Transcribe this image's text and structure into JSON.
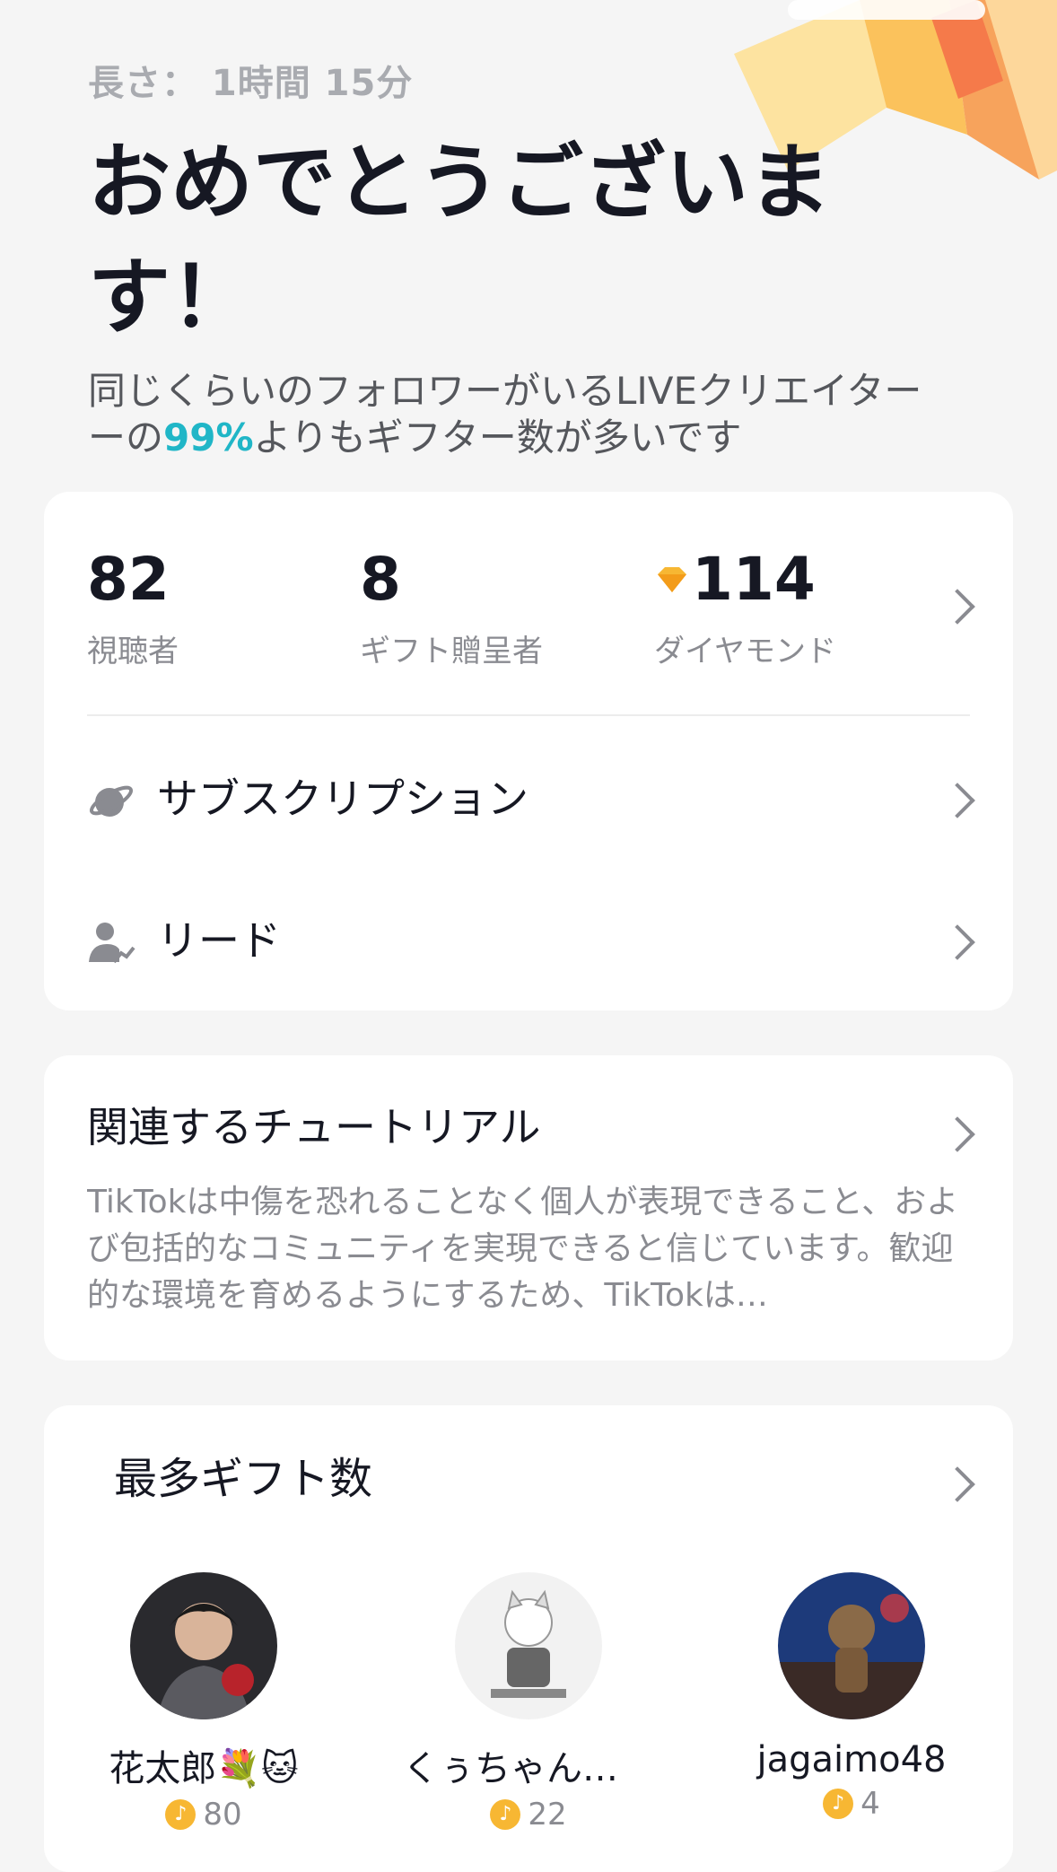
{
  "header": {
    "duration": "長さ： 1時間 15分",
    "title": "おめでとうございます！",
    "subtitle_pre": "同じくらいのフォロワーがいるLIVEクリエイター",
    "subtitle_prefix2": "ーの",
    "subtitle_pct": "99%",
    "subtitle_post": "よりもギフター数が多いです"
  },
  "stats": {
    "viewers": {
      "value": "82",
      "label": "視聴者"
    },
    "gifters": {
      "value": "8",
      "label": "ギフト贈呈者"
    },
    "diamonds": {
      "value": "114",
      "label": "ダイヤモンド",
      "icon": "diamond-icon"
    }
  },
  "rows": {
    "subscription": {
      "label": "サブスクリプション",
      "icon": "planet-icon"
    },
    "leads": {
      "label": "リード",
      "icon": "person-trend-icon"
    }
  },
  "tutorial": {
    "title": "関連するチュートリアル",
    "body": "TikTokは中傷を恐れることなく個人が表現できること、および包括的なコミュニティを実現できると信じています。歓迎的な環境を育めるようにするため、TikTokは…"
  },
  "top_gifters": {
    "title": "最多ギフト数",
    "items": [
      {
        "name": "花太郎💐🐱",
        "count": "80"
      },
      {
        "name": "くぅちゃん☠️…",
        "count": "22"
      },
      {
        "name": "jagaimo48",
        "count": "4"
      }
    ]
  },
  "colors": {
    "accent": "#20b6c7",
    "background": "#f5f5f5",
    "card": "#ffffff"
  }
}
